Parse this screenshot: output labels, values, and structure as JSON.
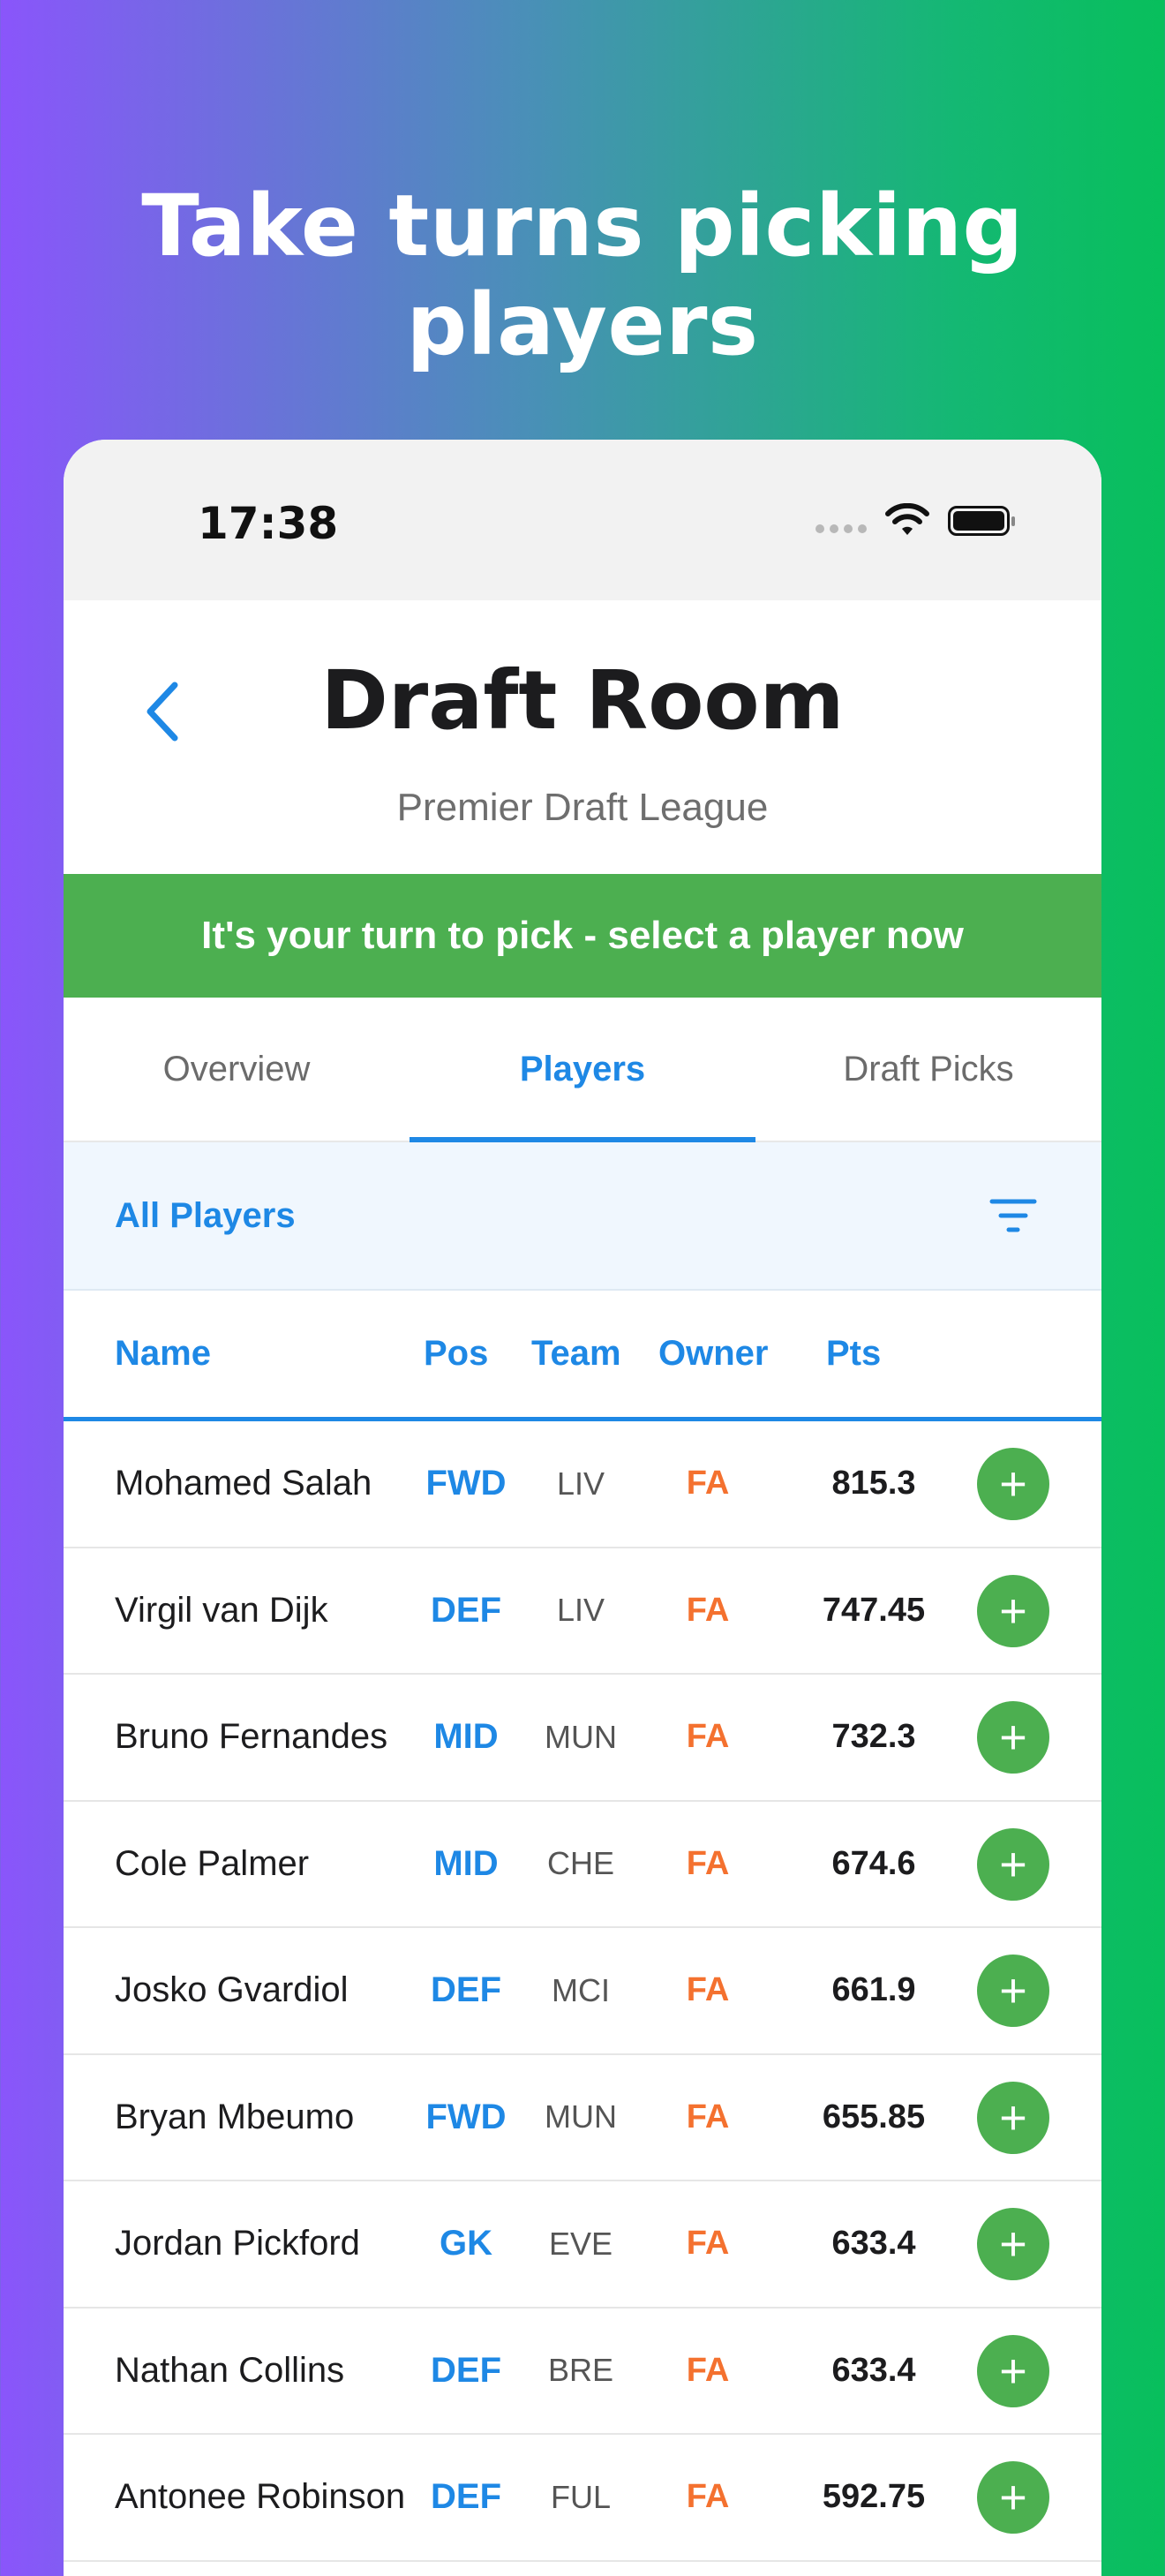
{
  "headline": "Take turns picking players",
  "status_bar": {
    "time": "17:38",
    "icons": [
      "signal-dots-icon",
      "wifi-icon",
      "battery-icon"
    ]
  },
  "nav": {
    "title": "Draft Room",
    "subtitle": "Premier Draft League",
    "back_icon": "chevron-left-icon"
  },
  "banner": "It's your turn to pick - select a player now",
  "tabs": [
    {
      "label": "Overview",
      "active": false
    },
    {
      "label": "Players",
      "active": true
    },
    {
      "label": "Draft Picks",
      "active": false
    }
  ],
  "filter": {
    "label": "All Players",
    "icon": "filter-icon"
  },
  "table": {
    "headers": {
      "name": "Name",
      "pos": "Pos",
      "team": "Team",
      "owner": "Owner",
      "pts": "Pts"
    },
    "rows": [
      {
        "name": "Mohamed Salah",
        "pos": "FWD",
        "team": "LIV",
        "owner": "FA",
        "pts": "815.3"
      },
      {
        "name": "Virgil van Dijk",
        "pos": "DEF",
        "team": "LIV",
        "owner": "FA",
        "pts": "747.45"
      },
      {
        "name": "Bruno Fernandes",
        "pos": "MID",
        "team": "MUN",
        "owner": "FA",
        "pts": "732.3"
      },
      {
        "name": "Cole Palmer",
        "pos": "MID",
        "team": "CHE",
        "owner": "FA",
        "pts": "674.6"
      },
      {
        "name": "Josko Gvardiol",
        "pos": "DEF",
        "team": "MCI",
        "owner": "FA",
        "pts": "661.9"
      },
      {
        "name": "Bryan Mbeumo",
        "pos": "FWD",
        "team": "MUN",
        "owner": "FA",
        "pts": "655.85"
      },
      {
        "name": "Jordan Pickford",
        "pos": "GK",
        "team": "EVE",
        "owner": "FA",
        "pts": "633.4"
      },
      {
        "name": "Nathan Collins",
        "pos": "DEF",
        "team": "BRE",
        "owner": "FA",
        "pts": "633.4"
      },
      {
        "name": "Antonee Robinson",
        "pos": "DEF",
        "team": "FUL",
        "owner": "FA",
        "pts": "592.75"
      }
    ],
    "add_symbol": "+"
  },
  "colors": {
    "accent": "#1e88e5",
    "success": "#4caf50",
    "owner": "#f4712f"
  }
}
